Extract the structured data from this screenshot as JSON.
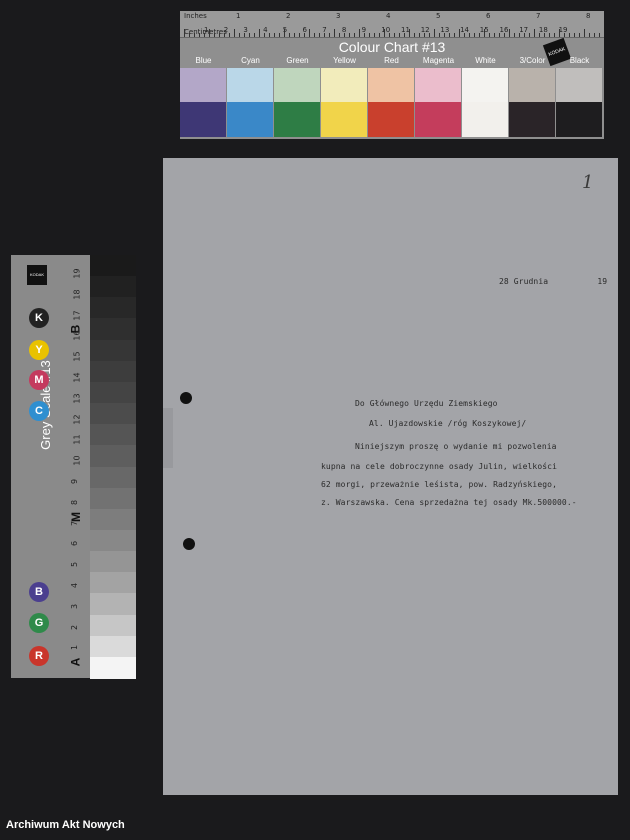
{
  "colour_chart": {
    "units_top": "Inches",
    "units_bottom": "Centimetres",
    "title": "Colour Chart #13",
    "patch_labels": [
      "Blue",
      "Cyan",
      "Green",
      "Yellow",
      "Red",
      "Magenta",
      "White",
      "3/Color",
      "Black"
    ],
    "top_colors": [
      "#b3a7c8",
      "#bad7e8",
      "#bfd6bd",
      "#f2ecbb",
      "#efc3a4",
      "#ebbdcc",
      "#f4f3f0",
      "#b9b2ab",
      "#c0bebc"
    ],
    "bottom_colors": [
      "#3e3775",
      "#3a88c8",
      "#2e7d45",
      "#f1d44a",
      "#c9402d",
      "#c43d5c",
      "#f2f0ec",
      "#2a2428",
      "#1e1d1f"
    ],
    "inch_numbers": [
      "1",
      "2",
      "3",
      "4",
      "5",
      "6",
      "7",
      "8"
    ],
    "cm_numbers": [
      "1",
      "2",
      "3",
      "4",
      "5",
      "6",
      "7",
      "8",
      "9",
      "10",
      "11",
      "12",
      "13",
      "14",
      "15",
      "16",
      "17",
      "18",
      "19"
    ],
    "logo": "KODAK"
  },
  "grey_scale": {
    "title": "Grey Scale #13",
    "circles": [
      {
        "label": "K",
        "color": "#222222"
      },
      {
        "label": "Y",
        "color": "#e9c200"
      },
      {
        "label": "M",
        "color": "#c43a5e"
      },
      {
        "label": "C",
        "color": "#2f8fd0"
      },
      {
        "label": "B",
        "color": "#4b3f8f"
      },
      {
        "label": "G",
        "color": "#2f8a4a"
      },
      {
        "label": "R",
        "color": "#c9352b"
      }
    ],
    "scale_numbers": [
      "19",
      "18",
      "17",
      "16",
      "15",
      "14",
      "13",
      "12",
      "11",
      "10",
      "9",
      "8",
      "7",
      "6",
      "5",
      "4",
      "3",
      "2",
      "1"
    ],
    "letters": [
      "B",
      "M",
      "A"
    ],
    "swatch_levels": [
      "#1a1a1a",
      "#212121",
      "#282828",
      "#2f2f2f",
      "#363636",
      "#3d3d3d",
      "#444444",
      "#4c4c4c",
      "#555555",
      "#5e5e5e",
      "#686868",
      "#727272",
      "#7d7d7d",
      "#888888",
      "#959595",
      "#a3a3a3",
      "#b3b3b3",
      "#c6c6c6",
      "#dadada",
      "#f4f4f4"
    ]
  },
  "document": {
    "page_number": "1",
    "date": "28 Grudnia          19",
    "addressee_line1": "Do Głównego Urzędu Ziemskiego",
    "addressee_line2": "Al. Ujazdowskie /róg Koszykowej/",
    "body_lines": [
      "Niniejszym proszę o wydanie mi pozwolenia",
      "kupna na cele dobroczynne osady Julin, wielkości",
      "62 morgi, przeważnie leśista, pow. Radzyńskiego,",
      "z. Warszawska. Cena sprzedażna tej osady Mk.500000.-"
    ]
  },
  "footer": {
    "text": "Archiwum Akt Nowych"
  }
}
